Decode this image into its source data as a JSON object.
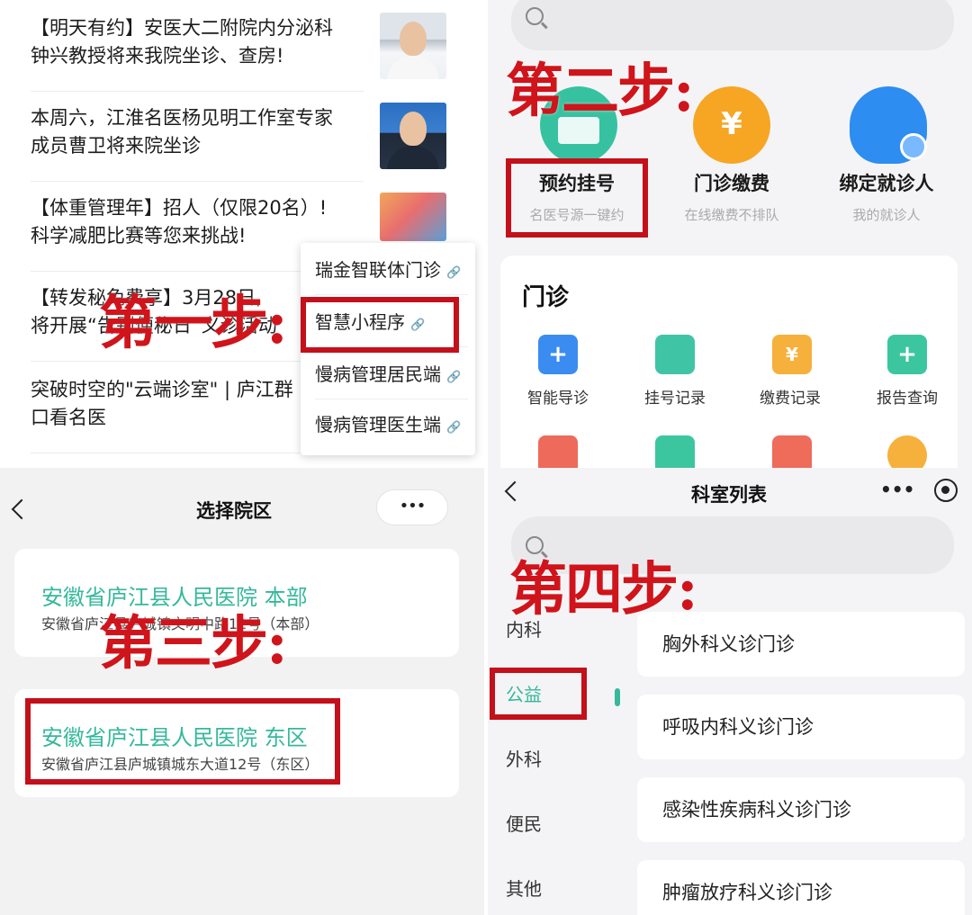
{
  "panel1": {
    "news": [
      {
        "title_line1": "【明天有约】安医大二附院内分泌科",
        "title_line2": "钟兴教授将来我院坐诊、查房!"
      },
      {
        "title_line1": "本周六，江淮名医杨见明工作室专家",
        "title_line2": "成员曹卫将来院坐诊"
      },
      {
        "title_line1": "【体重管理年】招人（仅限20名）!",
        "title_line2": "科学减肥比赛等您来挑战!"
      },
      {
        "title_line1": "【转发秘免费享】3月28日,",
        "title_line2": "将开展“告别便秘日”义诊活动"
      },
      {
        "title_line1": "突破时空的\"云端诊室\" | 庐江群",
        "title_line2": "口看名医"
      }
    ],
    "popup": [
      "瑞金智联体门诊",
      "智慧小程序",
      "慢病管理居民端",
      "慢病管理医生端"
    ],
    "link_glyph": "🔗",
    "step": "第一步:"
  },
  "panel2": {
    "services": [
      {
        "label": "预约挂号",
        "sub": "名医号源一键约"
      },
      {
        "label": "门诊缴费",
        "sub": "在线缴费不排队"
      },
      {
        "label": "绑定就诊人",
        "sub": "我的就诊人"
      }
    ],
    "clinic_title": "门诊",
    "grid": [
      "智能导诊",
      "挂号记录",
      "缴费记录",
      "报告查询"
    ],
    "yen": "¥",
    "plus": "+",
    "step": "第二步:"
  },
  "panel3": {
    "title": "选择院区",
    "capsule": "•••",
    "campuses": [
      {
        "name": "安徽省庐江县人民医院 本部",
        "addr": "安徽省庐江县庐城镇文明中路12号（本部）"
      },
      {
        "name": "安徽省庐江县人民医院 东区",
        "addr": "安徽省庐江县庐城镇城东大道12号（东区）"
      }
    ],
    "step": "第三步:"
  },
  "panel4": {
    "title": "科室列表",
    "more": "•••",
    "menu": [
      "内科",
      "公益",
      "外科",
      "便民",
      "其他"
    ],
    "active_menu": "公益",
    "departments": [
      "胸外科义诊门诊",
      "呼吸内科义诊门诊",
      "感染性疾病科义诊门诊",
      "肿瘤放疗科义诊门诊"
    ],
    "step": "第四步:"
  },
  "colors": {
    "accent": "#35b89c",
    "annotation_red": "#c4101a"
  }
}
